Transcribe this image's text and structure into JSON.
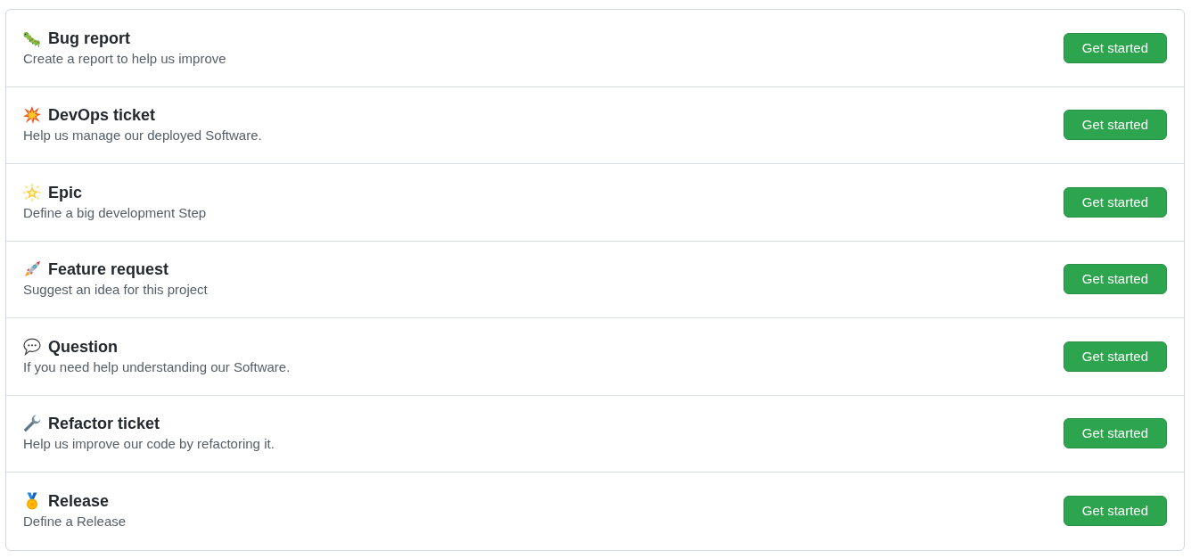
{
  "templates": [
    {
      "title": "Bug report",
      "description": "Create a report to help us improve",
      "button": "Get started"
    },
    {
      "title": "DevOps ticket",
      "description": "Help us manage our deployed Software.",
      "button": "Get started"
    },
    {
      "title": "Epic",
      "description": "Define a big development Step",
      "button": "Get started"
    },
    {
      "title": "Feature request",
      "description": "Suggest an idea for this project",
      "button": "Get started"
    },
    {
      "title": "Question",
      "description": "If you need help understanding our Software.",
      "button": "Get started"
    },
    {
      "title": "Refactor ticket",
      "description": "Help us improve our code by refactoring it.",
      "button": "Get started"
    },
    {
      "title": "Release",
      "description": "Define a Release",
      "button": "Get started"
    }
  ]
}
